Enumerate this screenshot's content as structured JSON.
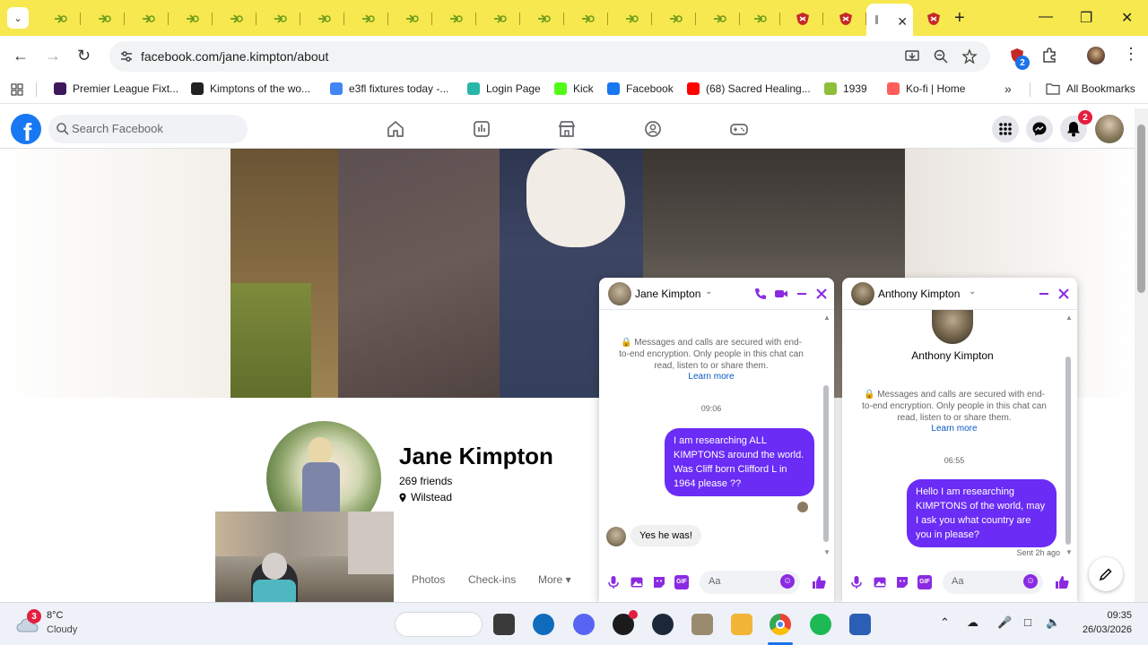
{
  "browser": {
    "address_url": "facebook.com/jane.kimpton/about",
    "extension_badge": "2",
    "bookmarks": [
      {
        "label": "Premier League Fixt...",
        "color": "#3d195b"
      },
      {
        "label": "Kimptons of the wo...",
        "color": "#222222"
      },
      {
        "label": "e3fl fixtures today -...",
        "color": "#4285f4"
      },
      {
        "label": "Login Page",
        "color": "#27b7a8"
      },
      {
        "label": "Kick",
        "color": "#53fc18"
      },
      {
        "label": "Facebook",
        "color": "#1877f2"
      },
      {
        "label": "(68) Sacred Healing...",
        "color": "#ff0000"
      },
      {
        "label": "1939",
        "color": "#8fbf3a"
      },
      {
        "label": "Ko-fi | Home",
        "color": "#ff5e5b"
      }
    ],
    "all_bookmarks_label": "All Bookmarks"
  },
  "facebook": {
    "search_placeholder": "Search Facebook",
    "notification_count": "2",
    "profile": {
      "name": "Jane Kimpton",
      "friends": "269 friends",
      "location": "Wilstead"
    },
    "profile_tabs": [
      "Photos",
      "Check-ins",
      "More ▾"
    ]
  },
  "chats": [
    {
      "name": "Jane Kimpton",
      "encryption_note": "Messages and calls are secured with end-to-end encryption. Only people in this chat can read, listen to or share them.",
      "learn_more": "Learn more",
      "time": "09:06",
      "outgoing": "I am researching ALL KIMPTONS around the world.  Was Cliff born Clifford L in 1964 please ??",
      "incoming": "Yes he was!",
      "input_placeholder": "Aa"
    },
    {
      "name": "Anthony Kimpton",
      "header_name": "Anthony Kimpton",
      "encryption_note": "Messages and calls are secured with end-to-end encryption. Only people in this chat can read, listen to or share them.",
      "learn_more": "Learn more",
      "time": "06:55",
      "outgoing": "Hello I am researching KIMPTONS of the world, may I ask you what country are you in please?",
      "status": "Sent 2h ago",
      "input_placeholder": "Aa"
    }
  ],
  "taskbar": {
    "weather_temp": "8°C",
    "weather_desc": "Cloudy",
    "weather_badge": "3",
    "time": "09:35",
    "date": "26/03/2026"
  },
  "colors": {
    "tabstrip": "#f6e84e",
    "facebook_blue": "#1877f2",
    "messenger_purple": "#6b2cf5"
  }
}
